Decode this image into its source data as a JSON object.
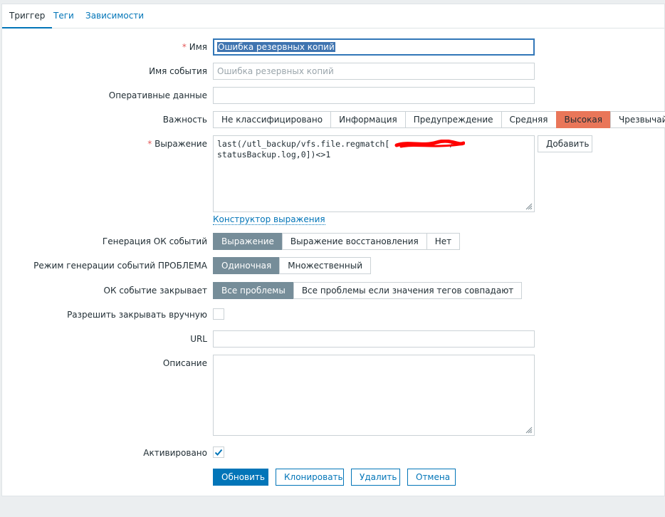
{
  "tabs": [
    {
      "label": "Триггер",
      "active": true
    },
    {
      "label": "Теги",
      "active": false
    },
    {
      "label": "Зависимости",
      "active": false
    }
  ],
  "form": {
    "name": {
      "label": "Имя",
      "required": "*",
      "value": "Ошибка резервных копий"
    },
    "event_name": {
      "label": "Имя события",
      "placeholder": "Ошибка резервных копий"
    },
    "opdata": {
      "label": "Оперативные данные",
      "value": ""
    },
    "severity": {
      "label": "Важность",
      "options": [
        "Не классифицировано",
        "Информация",
        "Предупреждение",
        "Средняя",
        "Высокая",
        "Чрезвычайная"
      ],
      "selected": "Высокая",
      "selected_color": "#e97659"
    },
    "expression": {
      "label": "Выражение",
      "required": "*",
      "line1": "last(/utl_backup/vfs.file.regmatch[",
      "line1_tail": "/",
      "line2": "statusBackup.log,0])<>1",
      "add_button": "Добавить",
      "constructor_link": "Конструктор выражения"
    },
    "ok_event_generation": {
      "label": "Генерация ОК событий",
      "options": [
        "Выражение",
        "Выражение восстановления",
        "Нет"
      ],
      "selected": "Выражение"
    },
    "problem_mode": {
      "label": "Режим генерации событий ПРОБЛЕМА",
      "options": [
        "Одиночная",
        "Множественный"
      ],
      "selected": "Одиночная"
    },
    "ok_closes": {
      "label": "ОК событие закрывает",
      "options": [
        "Все проблемы",
        "Все проблемы если значения тегов совпадают"
      ],
      "selected": "Все проблемы"
    },
    "manual_close": {
      "label": "Разрешить закрывать вручную",
      "checked": false
    },
    "url": {
      "label": "URL",
      "value": ""
    },
    "description": {
      "label": "Описание",
      "value": ""
    },
    "enabled": {
      "label": "Активировано",
      "checked": true
    }
  },
  "actions": {
    "update": "Обновить",
    "clone": "Клонировать",
    "delete": "Удалить",
    "cancel": "Отмена"
  },
  "colors": {
    "accent": "#0275b8",
    "selected_segment": "#768d99",
    "required": "#e45959",
    "redaction": "#ff0000"
  }
}
